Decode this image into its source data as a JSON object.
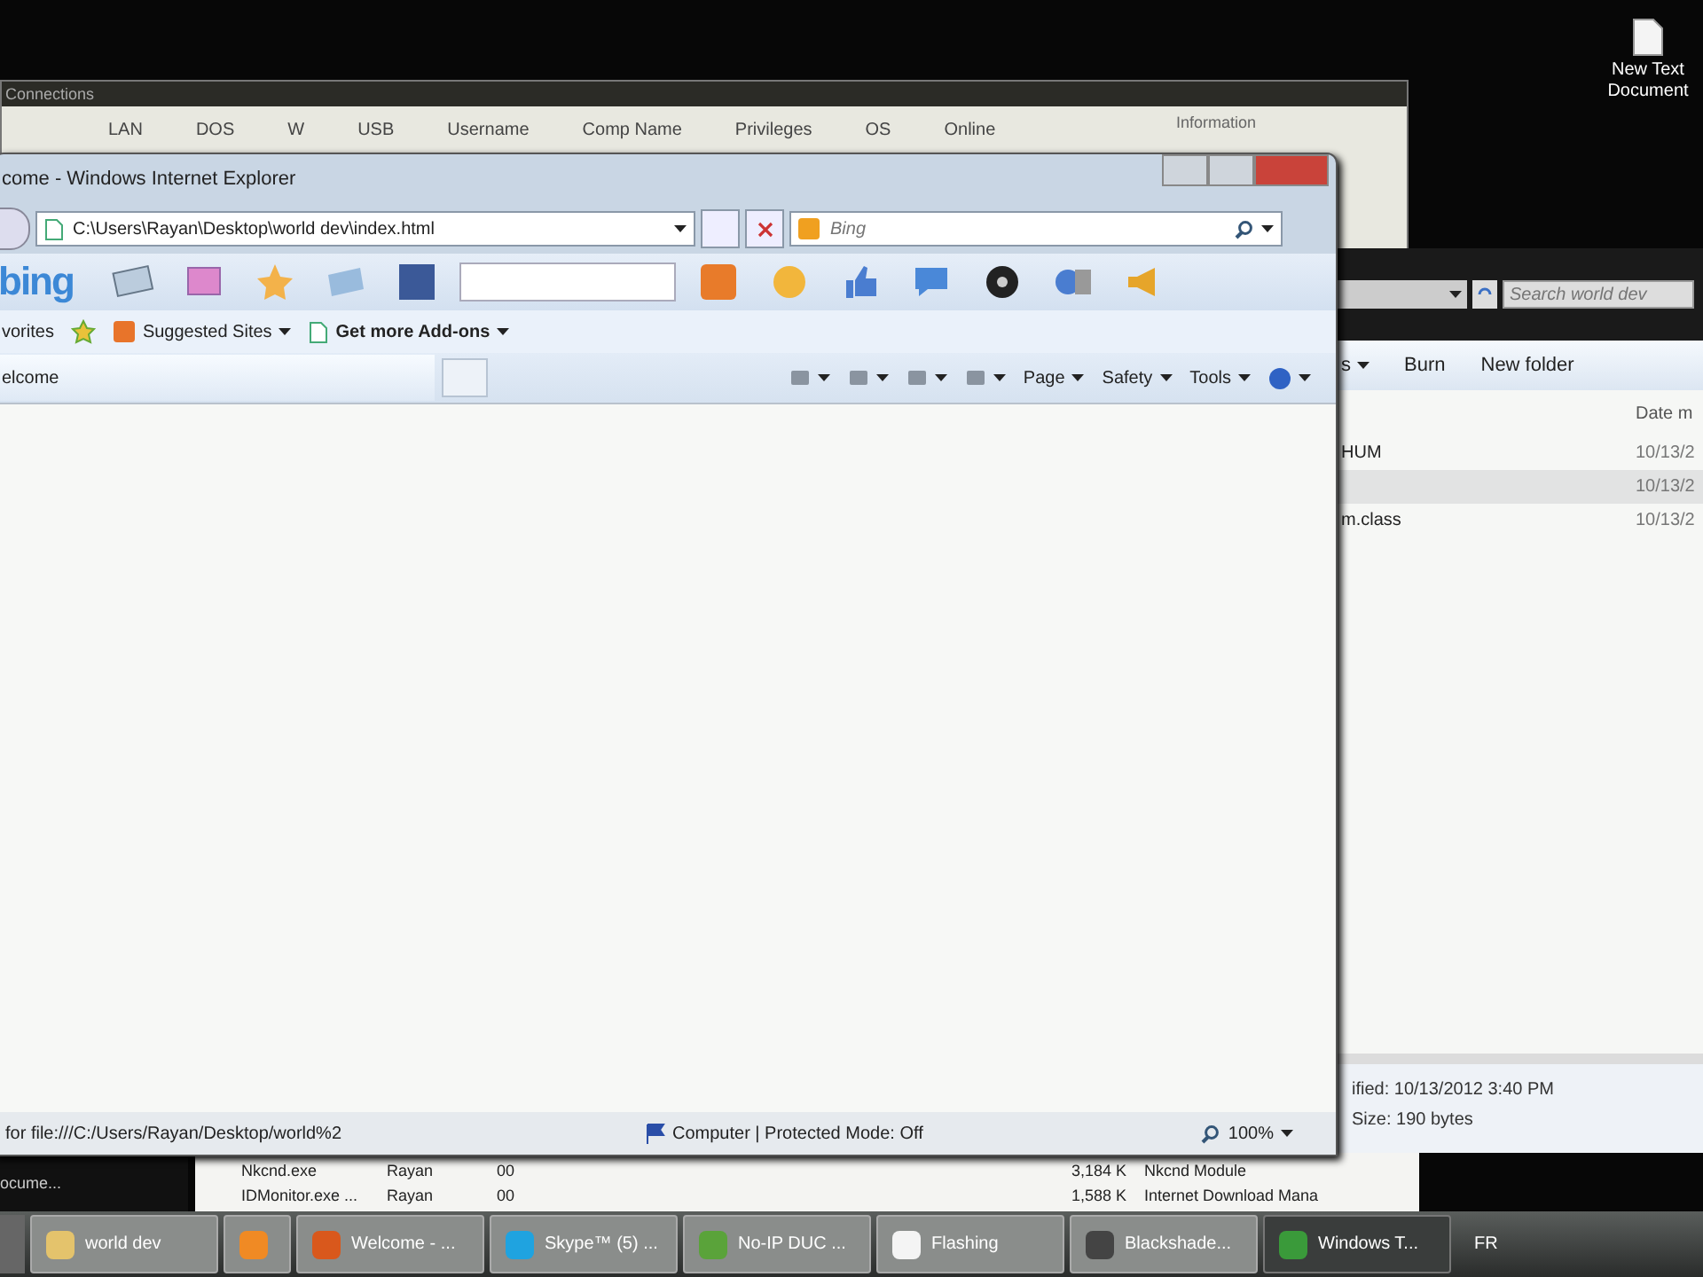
{
  "desktop": {
    "icons": [
      {
        "label": "New Text Document"
      }
    ]
  },
  "connections_window": {
    "title": "Connections",
    "columns": [
      "LAN",
      "DOS",
      "W",
      "USB",
      "Username",
      "Comp Name",
      "Privileges",
      "OS",
      "Online"
    ],
    "panel_label": "Information"
  },
  "explorer": {
    "search_placeholder": "Search world dev",
    "toolbar": [
      "s",
      "Burn",
      "New folder"
    ],
    "date_column": "Date m",
    "files": [
      {
        "name": "HUM",
        "date": "10/13/2",
        "selected": false
      },
      {
        "date": "10/13/2",
        "selected": true
      },
      {
        "name": "m.class",
        "date": "10/13/2",
        "selected": false
      }
    ],
    "details": [
      "ified: 10/13/2012 3:40 PM",
      "Size: 190 bytes"
    ]
  },
  "browser": {
    "title": "come - Windows Internet Explorer",
    "address": "C:\\Users\\Rayan\\Desktop\\world dev\\index.html",
    "search_placeholder": "Bing",
    "brand": "bing",
    "favorites_label": "vorites",
    "favorites": [
      "Suggested Sites",
      "Get more Add-ons"
    ],
    "tab": "elcome",
    "commands": [
      "Page",
      "Safety",
      "Tools"
    ],
    "status_text": "for file:///C:/Users/Rayan/Desktop/world%2",
    "zone": "Computer | Protected Mode: Off",
    "zoom": "100%"
  },
  "console_window": {
    "title": "ocume..."
  },
  "process_list": {
    "rows": [
      [
        "Nkcnd.exe",
        "Rayan",
        "00",
        "3,184 K",
        "Nkcnd Module"
      ],
      [
        "IDMonitor.exe ...",
        "Rayan",
        "00",
        "1,588 K",
        "Internet Download Mana"
      ]
    ]
  },
  "taskbar": {
    "items": [
      {
        "label": "world dev",
        "selected": false
      },
      {
        "selected": false
      },
      {
        "label": "Welcome - ...",
        "selected": false
      },
      {
        "label": "Skype™ (5) ...",
        "selected": false
      },
      {
        "label": "No-IP DUC ...",
        "selected": false
      },
      {
        "label": "Flashing",
        "selected": false
      },
      {
        "label": "Blackshade...",
        "selected": false
      },
      {
        "label": "Windows T...",
        "selected": true
      }
    ],
    "language": "FR"
  }
}
